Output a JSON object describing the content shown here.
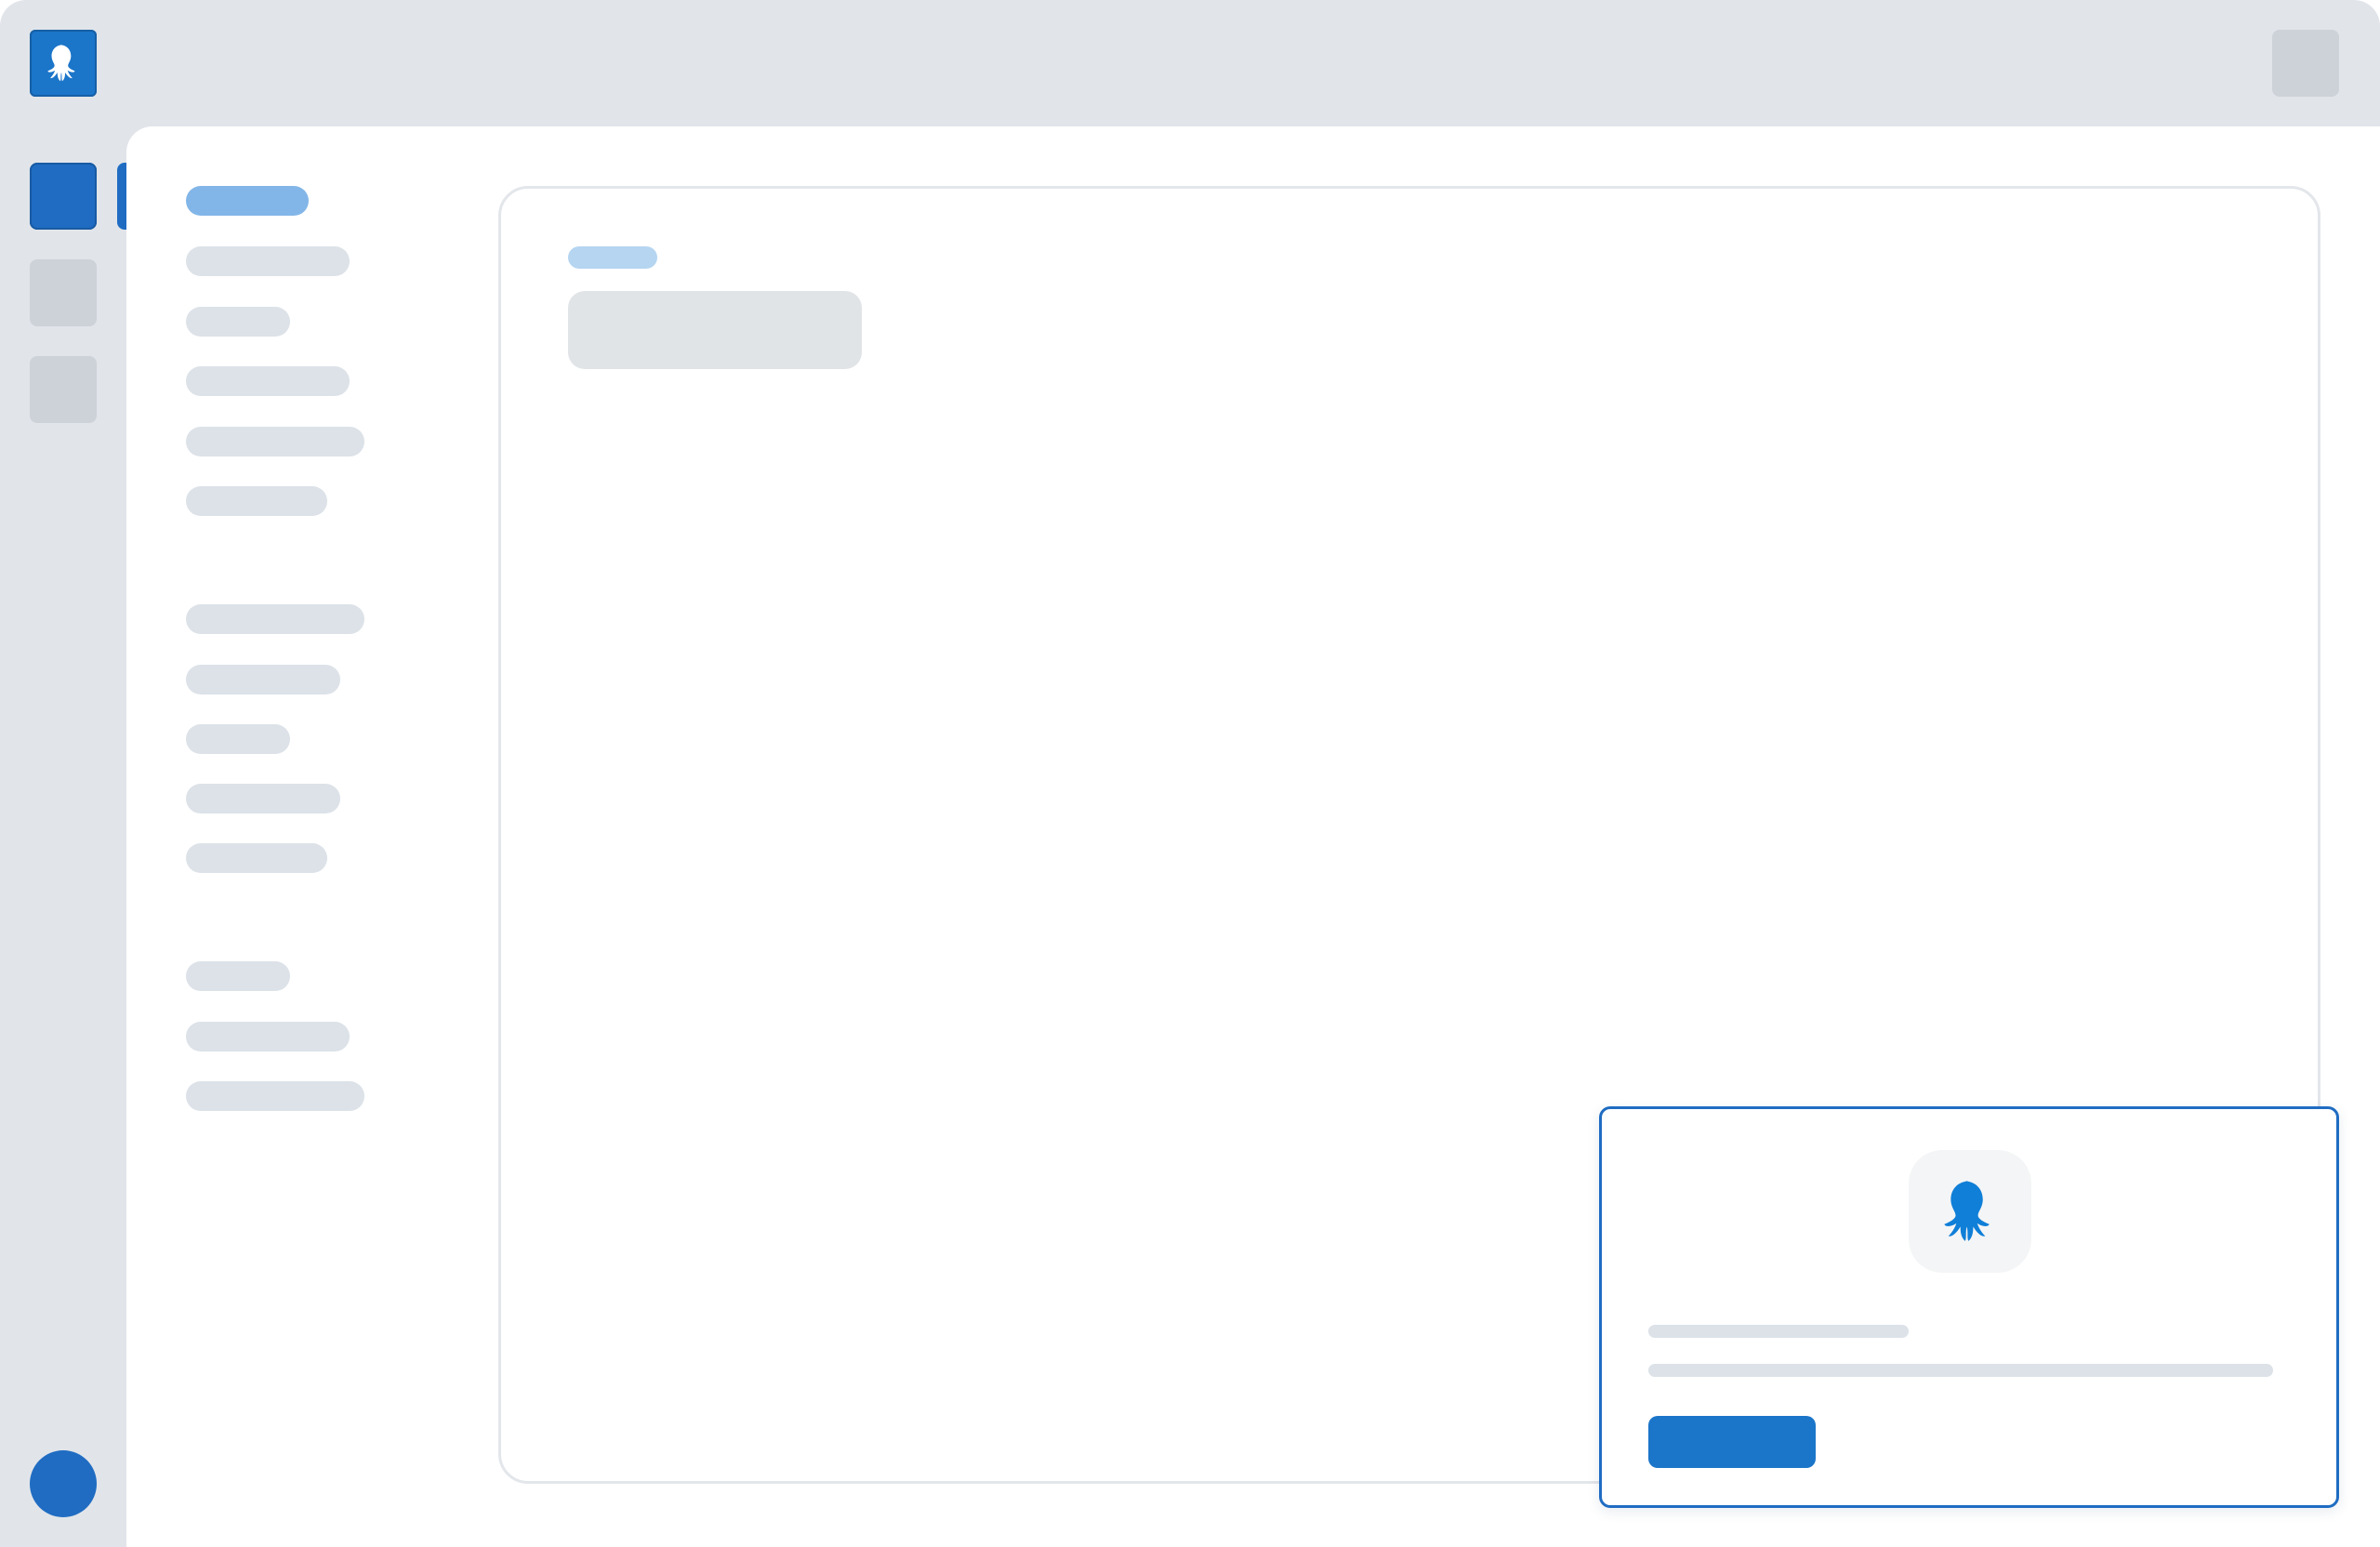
{
  "app": {
    "brand_icon": "octopus-icon",
    "accent_color": "#1f6cc2",
    "surface_color": "#e1e5ea",
    "placeholder_color": "#dce2e8"
  },
  "rail": {
    "items": [
      {
        "name": "rail-item-1",
        "state": "active"
      },
      {
        "name": "rail-item-2",
        "state": "inactive"
      },
      {
        "name": "rail-item-3",
        "state": "inactive"
      }
    ],
    "user_avatar": "avatar"
  },
  "secondary_nav": {
    "groups": [
      {
        "items": [
          {
            "state": "selected"
          },
          {},
          {},
          {},
          {},
          {}
        ]
      },
      {
        "items": [
          {},
          {},
          {},
          {},
          {}
        ]
      },
      {
        "items": [
          {},
          {},
          {}
        ]
      }
    ]
  },
  "main_card": {
    "tag_color": "#b5d5f1"
  },
  "popup": {
    "icon": "octopus-icon",
    "icon_color": "#0f7fd8",
    "button_color": "#1b75c9",
    "border_color": "#1f6cc2"
  }
}
